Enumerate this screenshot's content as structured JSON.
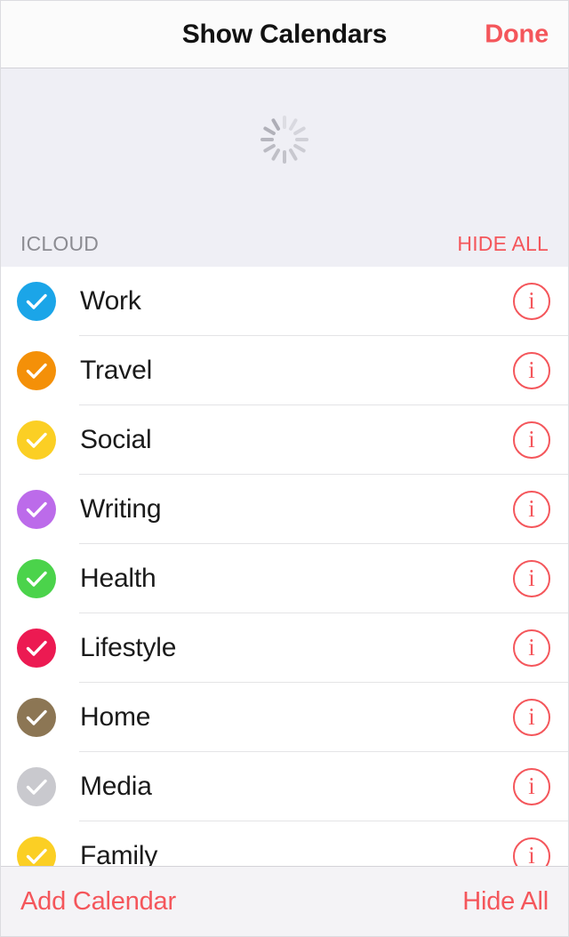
{
  "navbar": {
    "title": "Show Calendars",
    "done_label": "Done"
  },
  "loading": {
    "spinner_name": "activity-indicator",
    "spinner_spokes": 12
  },
  "section": {
    "title": "ICLOUD",
    "action_label": "HIDE ALL"
  },
  "colors": {
    "accent_red": "#f4565b",
    "section_bg": "#efeff5",
    "navbar_bg": "#fbfbfb",
    "toolbar_bg": "#f4f3f6",
    "separator": "#e4e4e6",
    "label_text": "#1a1a1a",
    "section_title_text": "#8c8c92"
  },
  "calendars": [
    {
      "label": "Work",
      "color": "#1ba5e8",
      "checked": true,
      "info_label": "i"
    },
    {
      "label": "Travel",
      "color": "#f49008",
      "checked": true,
      "info_label": "i"
    },
    {
      "label": "Social",
      "color": "#fbcf24",
      "checked": true,
      "info_label": "i"
    },
    {
      "label": "Writing",
      "color": "#bc6bea",
      "checked": true,
      "info_label": "i"
    },
    {
      "label": "Health",
      "color": "#4bd34b",
      "checked": true,
      "info_label": "i"
    },
    {
      "label": "Lifestyle",
      "color": "#ec1a52",
      "checked": true,
      "info_label": "i"
    },
    {
      "label": "Home",
      "color": "#8c7654",
      "checked": true,
      "info_label": "i"
    },
    {
      "label": "Media",
      "color": "#c9c9ce",
      "checked": true,
      "info_label": "i"
    },
    {
      "label": "Family",
      "color": "#fbcf24",
      "checked": true,
      "info_label": "i"
    }
  ],
  "toolbar": {
    "add_label": "Add Calendar",
    "hide_all_label": "Hide All"
  }
}
